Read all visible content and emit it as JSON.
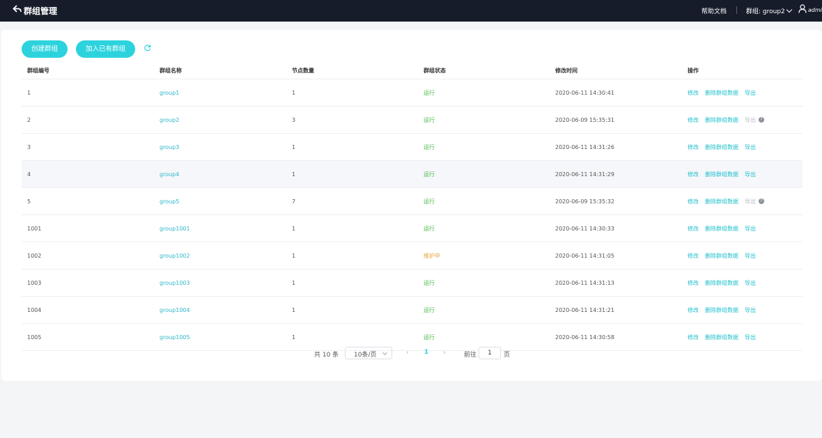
{
  "header": {
    "title": "群组管理",
    "help": "帮助文档",
    "group_switch": "群组: group2",
    "user": "admin"
  },
  "toolbar": {
    "create_label": "创建群组",
    "join_label": "加入已有群组"
  },
  "table": {
    "columns": [
      "群组编号",
      "群组名称",
      "节点数量",
      "群组状态",
      "修改时间",
      "操作"
    ],
    "rows": [
      {
        "id": "1",
        "name": "group1",
        "nodes": "1",
        "status": "运行",
        "time": "2020-06-11 14:30:41",
        "edit": "修改",
        "delete": "删除群组数据",
        "export": "导出"
      },
      {
        "id": "2",
        "name": "group2",
        "nodes": "3",
        "status": "运行",
        "time": "2020-06-09 15:35:31",
        "edit": "修改",
        "delete": "删除群组数据",
        "export": "导出"
      },
      {
        "id": "3",
        "name": "group3",
        "nodes": "1",
        "status": "运行",
        "time": "2020-06-11 14:31:26",
        "edit": "修改",
        "delete": "删除群组数据",
        "export": "导出"
      },
      {
        "id": "4",
        "name": "group4",
        "nodes": "1",
        "status": "运行",
        "time": "2020-06-11 14:31:29",
        "edit": "修改",
        "delete": "删除群组数据",
        "export": "导出"
      },
      {
        "id": "5",
        "name": "group5",
        "nodes": "7",
        "status": "运行",
        "time": "2020-06-09 15:35:32",
        "edit": "修改",
        "delete": "删除群组数据",
        "export": "导出"
      },
      {
        "id": "1001",
        "name": "group1001",
        "nodes": "1",
        "status": "运行",
        "time": "2020-06-11 14:30:33",
        "edit": "修改",
        "delete": "删除群组数据",
        "export": "导出"
      },
      {
        "id": "1002",
        "name": "group1002",
        "nodes": "1",
        "status": "维护中",
        "time": "2020-06-11 14:31:05",
        "edit": "修改",
        "delete": "删除群组数据",
        "export": "导出"
      },
      {
        "id": "1003",
        "name": "group1003",
        "nodes": "1",
        "status": "运行",
        "time": "2020-06-11 14:31:13",
        "edit": "修改",
        "delete": "删除群组数据",
        "export": "导出"
      },
      {
        "id": "1004",
        "name": "group1004",
        "nodes": "1",
        "status": "运行",
        "time": "2020-06-11 14:31:21",
        "edit": "修改",
        "delete": "删除群组数据",
        "export": "导出"
      },
      {
        "id": "1005",
        "name": "group1005",
        "nodes": "1",
        "status": "运行",
        "time": "2020-06-11 14:30:58",
        "edit": "修改",
        "delete": "删除群组数据",
        "export": "导出"
      }
    ]
  },
  "pagination": {
    "total": "共 10 条",
    "page_size": "10条/页",
    "current_page": "1",
    "goto_label": "前往",
    "goto_value": "1",
    "page_unit": "页"
  },
  "colors": {
    "accent": "#2cd3dd",
    "header_bg": "#171c2b",
    "status_running": "#4bb84b",
    "status_maintenance": "#e6a23c"
  }
}
